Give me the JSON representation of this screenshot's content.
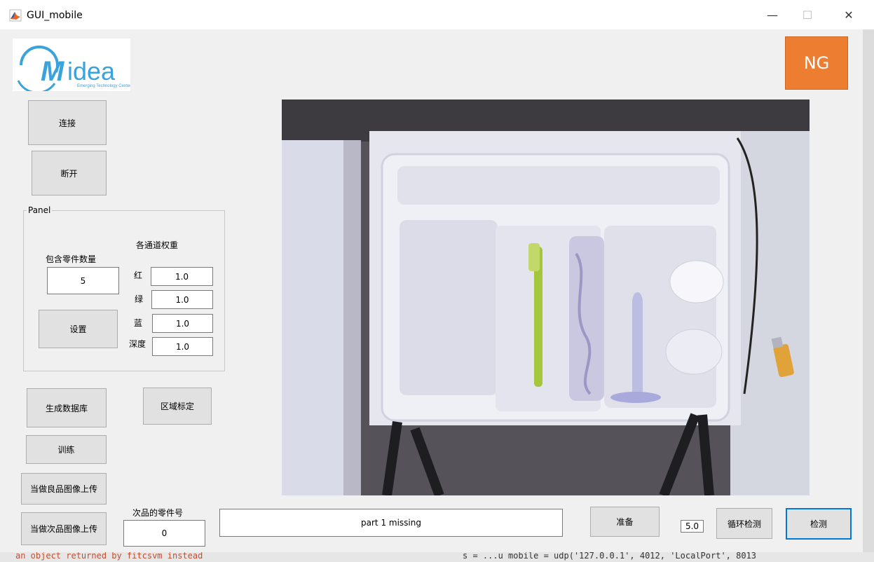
{
  "window": {
    "title": "GUI_mobile",
    "minimize": "—",
    "maximize": "☐",
    "close": "✕"
  },
  "logo": {
    "brand": "Midea",
    "subtitle": "Emerging Technology Center",
    "color": "#3aa3dc"
  },
  "status": {
    "result": "NG",
    "color": "#ed7d31"
  },
  "buttons": {
    "connect": "连接",
    "disconnect": "断开",
    "set": "设置",
    "gen_db": "生成数据库",
    "region": "区域标定",
    "train": "训练",
    "upload_good": "当做良品图像上传",
    "upload_bad": "当做次品图像上传",
    "prepare": "准备",
    "loop_detect": "循环检测",
    "detect": "检测"
  },
  "panel": {
    "title": "Panel",
    "part_count_label": "包含零件数量",
    "part_count_value": "5",
    "weights_title": "各通道权重",
    "channels": [
      {
        "label": "红",
        "value": "1.0"
      },
      {
        "label": "绿",
        "value": "1.0"
      },
      {
        "label": "蓝",
        "value": "1.0"
      },
      {
        "label": "深度",
        "value": "1.0"
      }
    ]
  },
  "defect": {
    "label": "次品的零件号",
    "value": "0"
  },
  "message": {
    "text": "part 1 missing"
  },
  "interval": {
    "value": "5.0"
  },
  "background_code": {
    "text": "an object returned by fitcsvm instead",
    "text2": "s = ...u mobile = udp('127.0.0.1', 4012, 'LocalPort', 8013"
  }
}
